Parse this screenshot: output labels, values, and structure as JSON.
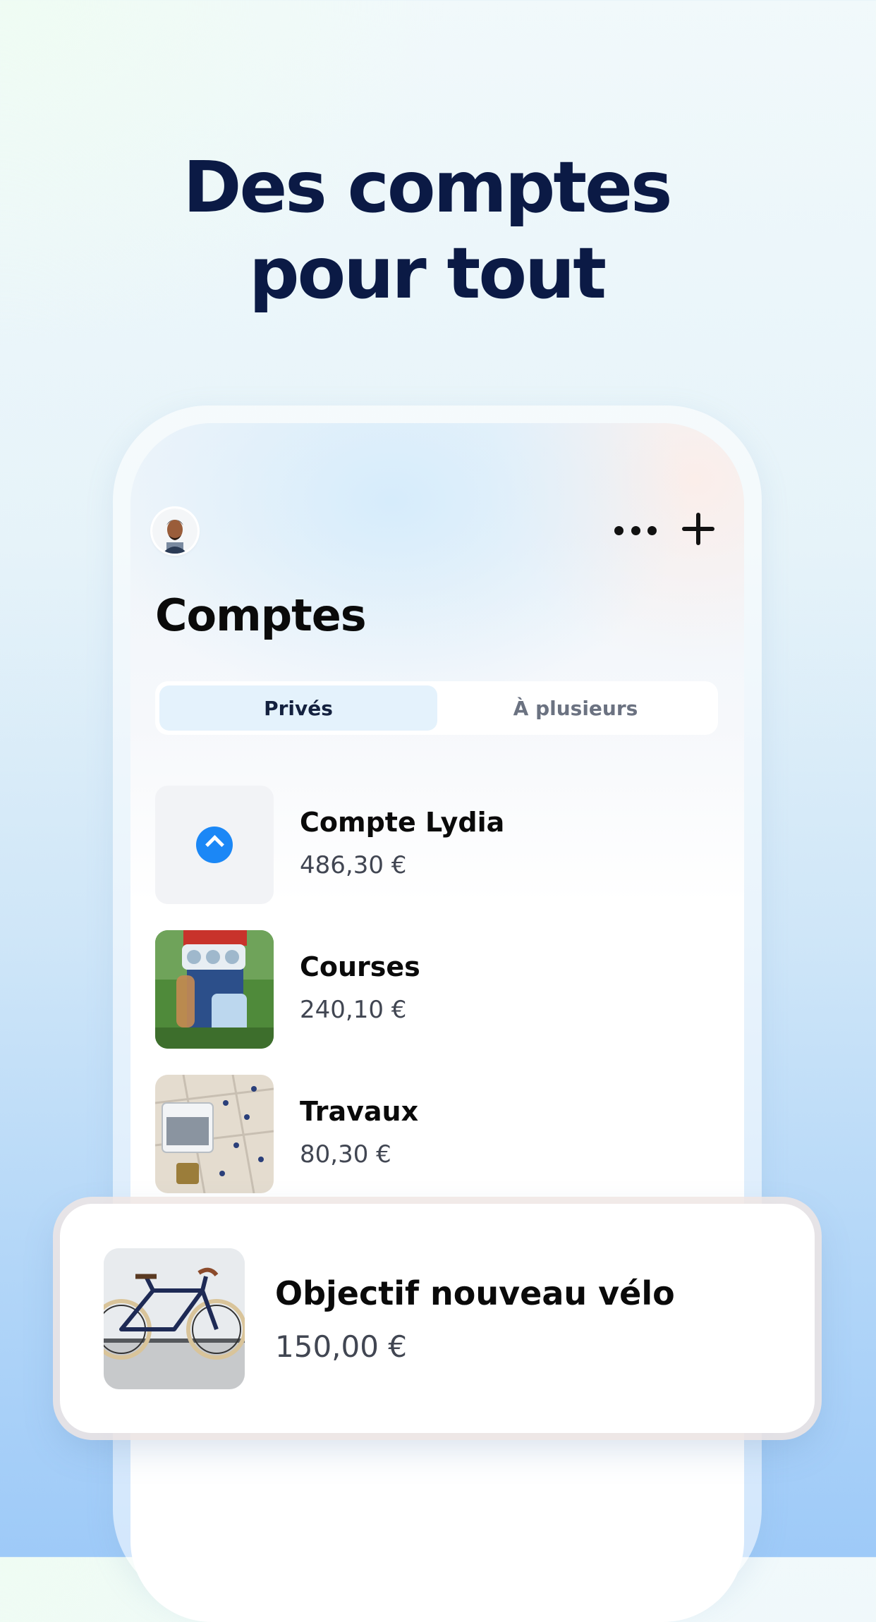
{
  "headline": {
    "line1": "Des comptes",
    "line2": "pour tout"
  },
  "header": {
    "avatar_icon": "user-avatar-icon",
    "more_icon": "more-horizontal-icon",
    "add_icon": "plus-icon"
  },
  "page_title": "Comptes",
  "tabs": [
    {
      "label": "Privés",
      "selected": true
    },
    {
      "label": "À plusieurs",
      "selected": false
    }
  ],
  "accounts": [
    {
      "name": "Compte Lydia",
      "amount": "486,30 €",
      "icon": "lydia-logo-icon"
    },
    {
      "name": "Courses",
      "amount": "240,10 €",
      "icon": "groceries-photo"
    },
    {
      "name": "Travaux",
      "amount": "80,30 €",
      "icon": "renovation-photo"
    }
  ],
  "featured_account": {
    "name": "Objectif nouveau vélo",
    "amount": "150,00 €",
    "icon": "bicycle-photo"
  },
  "colors": {
    "headline": "#0b1a45",
    "accent": "#1b87f6",
    "tab_active_bg": "#e4f2fc"
  }
}
